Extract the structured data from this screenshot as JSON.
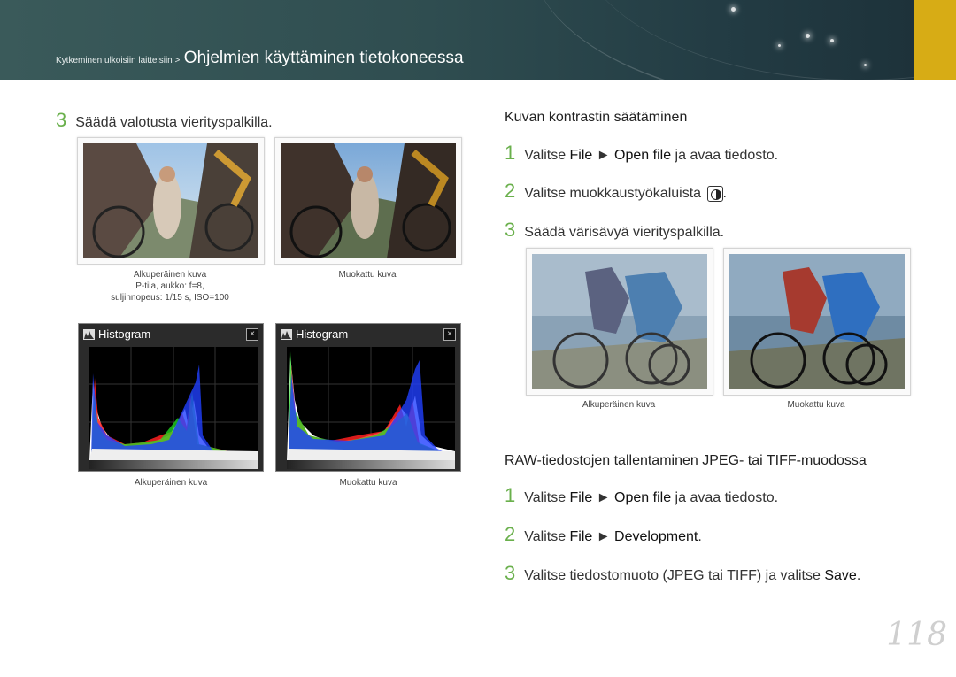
{
  "header": {
    "breadcrumb_small": "Kytkeminen ulkoisiin laitteisiin >",
    "breadcrumb_big": "Ohjelmien käyttäminen tietokoneessa"
  },
  "left": {
    "step3": {
      "num": "3",
      "text": "Säädä valotusta vierityspalkilla."
    },
    "photo_captions": {
      "original": "Alkuperäinen kuva",
      "original_line2": "P-tila, aukko: f=8,",
      "original_line3": "suljinnopeus: 1/15 s, ISO=100",
      "modified": "Muokattu kuva"
    },
    "histogram_title": "Histogram",
    "histogram_captions": {
      "original": "Alkuperäinen kuva",
      "modified": "Muokattu kuva"
    }
  },
  "right": {
    "contrast": {
      "title": "Kuvan kontrastin säätäminen",
      "step1": {
        "num": "1",
        "a": "Valitse ",
        "b": "File",
        "c": " ► ",
        "d": "Open file",
        "e": "  ja avaa tiedosto."
      },
      "step2": {
        "num": "2",
        "text": "Valitse muokkaustyökaluista ",
        "end": "."
      },
      "step3": {
        "num": "3",
        "text": "Säädä värisävyä vierityspalkilla."
      },
      "captions": {
        "original": "Alkuperäinen kuva",
        "modified": "Muokattu kuva"
      }
    },
    "raw": {
      "title": "RAW-tiedostojen tallentaminen JPEG- tai TIFF-muodossa",
      "step1": {
        "num": "1",
        "a": "Valitse ",
        "b": "File",
        "c": " ► ",
        "d": "Open file",
        "e": " ja avaa tiedosto."
      },
      "step2": {
        "num": "2",
        "a": "Valitse ",
        "b": "File",
        "c": " ► ",
        "d": "Development",
        "e": "."
      },
      "step3": {
        "num": "3",
        "a": "Valitse tiedostomuoto (JPEG tai TIFF) ja valitse ",
        "b": "Save",
        "c": "."
      }
    }
  },
  "page_number": "118",
  "colors": {
    "accent_green": "#6ab04c",
    "tab_gold": "#d7ac15"
  }
}
